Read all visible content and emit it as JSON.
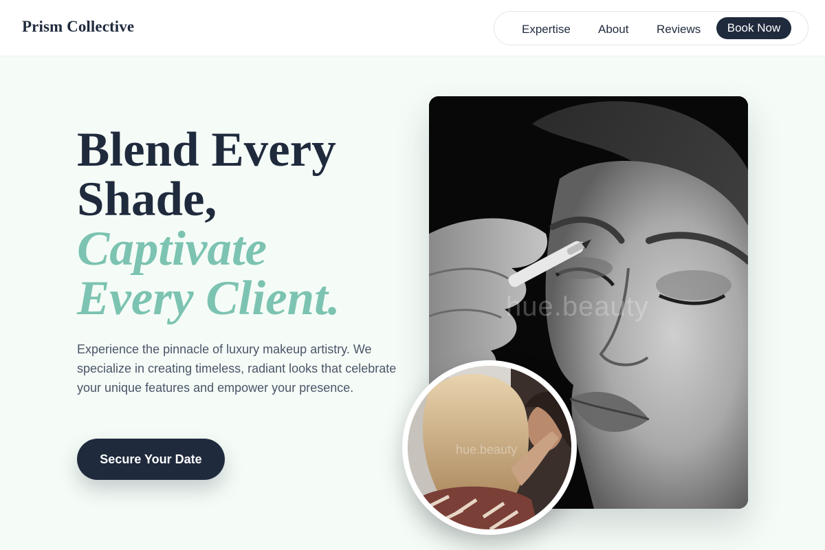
{
  "brand": {
    "name": "Prism Collective"
  },
  "nav": {
    "items": [
      {
        "label": "Expertise"
      },
      {
        "label": "About"
      },
      {
        "label": "Reviews"
      }
    ],
    "cta_label": "Book Now"
  },
  "hero": {
    "headline_lines": [
      "Blend Every",
      "Shade,"
    ],
    "accent_lines": [
      "Captivate",
      "Every Client."
    ],
    "description": "Experience the pinnacle of luxury makeup artistry. We specialize in creating timeless, radiant looks that celebrate your unique features and empower your presence.",
    "cta_label": "Secure Your Date"
  },
  "media": {
    "main_photo_watermark": "hue.beauty",
    "inset_photo_watermark": "hue.beauty"
  },
  "colors": {
    "navy": "#1f2a3d",
    "accent_teal": "#7cc3b1",
    "background": "#f5fcf7",
    "body_text": "#4a5568"
  }
}
